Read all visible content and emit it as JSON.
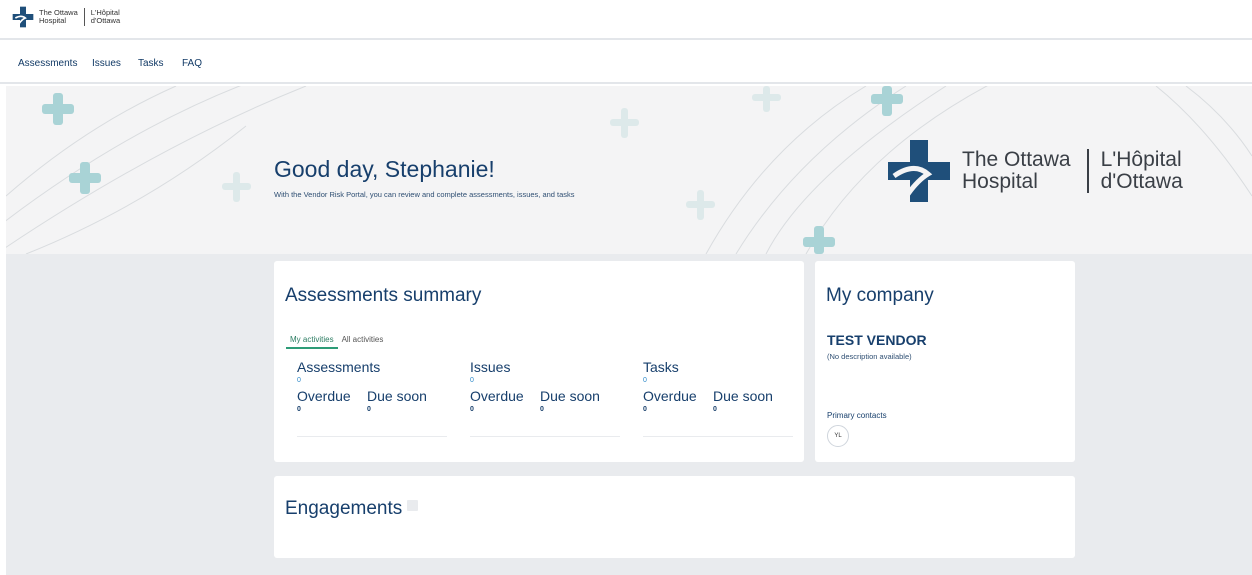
{
  "header": {
    "logo_en_line1": "The Ottawa",
    "logo_en_line2": "Hospital",
    "logo_fr_line1": "L'Hôpital",
    "logo_fr_line2": "d'Ottawa"
  },
  "nav": {
    "items": [
      {
        "label": "Assessments"
      },
      {
        "label": "Issues"
      },
      {
        "label": "Tasks"
      },
      {
        "label": "FAQ"
      }
    ]
  },
  "hero": {
    "greeting": "Good day, Stephanie!",
    "subtitle": "With the Vendor Risk Portal, you can review and complete assessments, issues, and tasks",
    "logo_en_line1": "The Ottawa",
    "logo_en_line2": "Hospital",
    "logo_fr_line1": "L'Hôpital",
    "logo_fr_line2": "d'Ottawa"
  },
  "summary": {
    "title": "Assessments summary",
    "tabs": [
      {
        "label": "My activities",
        "active": true
      },
      {
        "label": "All activities",
        "active": false
      }
    ],
    "columns": [
      {
        "heading": "Assessments",
        "count": "0",
        "overdue_label": "Overdue",
        "overdue": "0",
        "due_soon_label": "Due soon",
        "due_soon": "0"
      },
      {
        "heading": "Issues",
        "count": "0",
        "overdue_label": "Overdue",
        "overdue": "0",
        "due_soon_label": "Due soon",
        "due_soon": "0"
      },
      {
        "heading": "Tasks",
        "count": "0",
        "overdue_label": "Overdue",
        "overdue": "0",
        "due_soon_label": "Due soon",
        "due_soon": "0"
      }
    ]
  },
  "company": {
    "title": "My company",
    "vendor_name": "TEST VENDOR",
    "description": "(No description available)",
    "contacts_label": "Primary contacts",
    "contact_initials": "YL"
  },
  "engagements": {
    "title": "Engagements"
  },
  "colors": {
    "navy": "#173f6c",
    "teal_accent": "#2d9c77",
    "logo_blue": "#1f4f7a"
  }
}
